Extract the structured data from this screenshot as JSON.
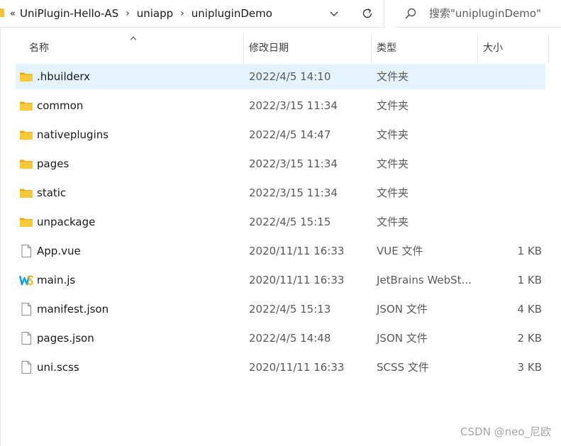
{
  "address": {
    "lead": "«",
    "crumbs": [
      "UniPlugin-Hello-AS",
      "uniapp",
      "unipluginDemo"
    ],
    "separator": "›"
  },
  "search": {
    "placeholder": "搜索\"unipluginDemo\""
  },
  "columns": {
    "name": "名称",
    "date": "修改日期",
    "type": "类型",
    "size": "大小"
  },
  "files": [
    {
      "name": ".hbuilderx",
      "date": "2022/4/5 14:10",
      "type": "文件夹",
      "size": "",
      "icon": "folder-icon"
    },
    {
      "name": "common",
      "date": "2022/3/15 11:34",
      "type": "文件夹",
      "size": "",
      "icon": "folder-icon"
    },
    {
      "name": "nativeplugins",
      "date": "2022/4/5 14:47",
      "type": "文件夹",
      "size": "",
      "icon": "folder-icon"
    },
    {
      "name": "pages",
      "date": "2022/3/15 11:34",
      "type": "文件夹",
      "size": "",
      "icon": "folder-icon"
    },
    {
      "name": "static",
      "date": "2022/3/15 11:34",
      "type": "文件夹",
      "size": "",
      "icon": "folder-icon"
    },
    {
      "name": "unpackage",
      "date": "2022/4/5 15:15",
      "type": "文件夹",
      "size": "",
      "icon": "folder-icon"
    },
    {
      "name": "App.vue",
      "date": "2020/11/11 16:33",
      "type": "VUE 文件",
      "size": "1 KB",
      "icon": "file-icon"
    },
    {
      "name": "main.js",
      "date": "2020/11/11 16:33",
      "type": "JetBrains WebSt...",
      "size": "1 KB",
      "icon": "webstorm-icon"
    },
    {
      "name": "manifest.json",
      "date": "2022/4/5 15:13",
      "type": "JSON 文件",
      "size": "4 KB",
      "icon": "file-icon"
    },
    {
      "name": "pages.json",
      "date": "2022/4/5 14:48",
      "type": "JSON 文件",
      "size": "2 KB",
      "icon": "file-icon"
    },
    {
      "name": "uni.scss",
      "date": "2020/11/11 16:33",
      "type": "SCSS 文件",
      "size": "3 KB",
      "icon": "file-icon"
    }
  ],
  "selected_index": 0,
  "watermark": "CSDN @neo_尼欧",
  "colors": {
    "folder": "#f3c230",
    "selection": "#e5f3ff",
    "webstorm_a": "#1ea2e6",
    "webstorm_b": "#f5b833"
  }
}
